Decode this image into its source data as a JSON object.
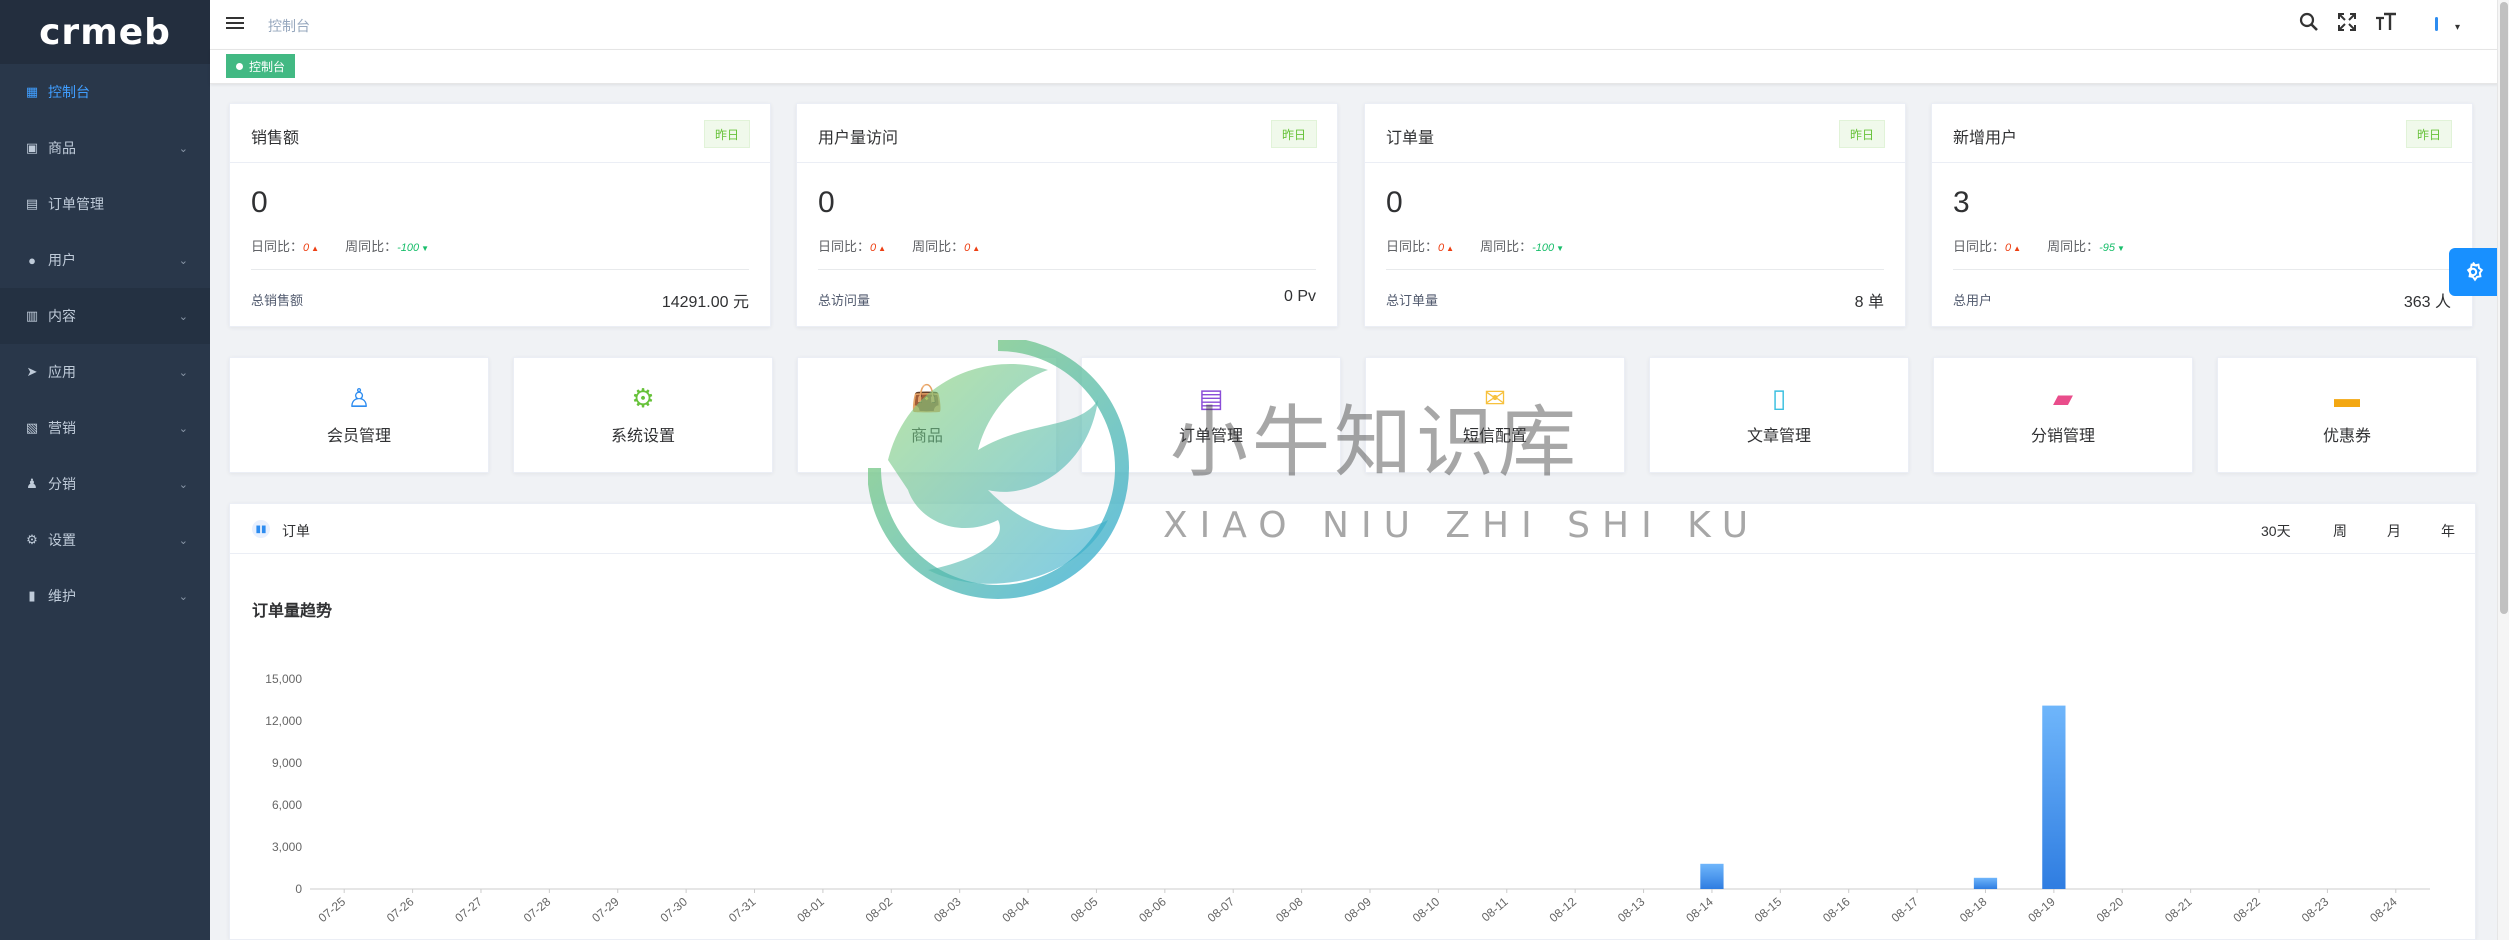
{
  "app": {
    "logo": "crmeb"
  },
  "sidebar": {
    "items": [
      {
        "label": "控制台",
        "icon": "dashboard-icon",
        "glyph": "▦",
        "active": true,
        "chevron": false
      },
      {
        "label": "商品",
        "icon": "bag-icon",
        "glyph": "▣",
        "chevron": true
      },
      {
        "label": "订单管理",
        "icon": "clipboard-icon",
        "glyph": "▤",
        "chevron": false
      },
      {
        "label": "用户",
        "icon": "user-icon",
        "glyph": "●",
        "chevron": true
      },
      {
        "label": "内容",
        "icon": "bar-chart-icon",
        "glyph": "▥",
        "chevron": true,
        "hover": true
      },
      {
        "label": "应用",
        "icon": "paper-plane-icon",
        "glyph": "➤",
        "chevron": true
      },
      {
        "label": "营销",
        "icon": "image-icon",
        "glyph": "▧",
        "chevron": true
      },
      {
        "label": "分销",
        "icon": "person-icon",
        "glyph": "♟",
        "chevron": true
      },
      {
        "label": "设置",
        "icon": "gear-icon",
        "glyph": "⚙",
        "chevron": true
      },
      {
        "label": "维护",
        "icon": "paint-roller-icon",
        "glyph": "▮",
        "chevron": true
      }
    ],
    "chevron_glyph": "⌄"
  },
  "header": {
    "breadcrumb": "控制台",
    "tags": [
      "控制台"
    ]
  },
  "stats": [
    {
      "title": "销售额",
      "badge": "昨日",
      "value": "0",
      "day_label": "日同比：",
      "day_value": "0",
      "day_dir": "up",
      "week_label": "周同比：",
      "week_value": "-100",
      "week_dir": "down",
      "total_label": "总销售额",
      "total_value": "14291.00 元"
    },
    {
      "title": "用户量访问",
      "badge": "昨日",
      "value": "0",
      "day_label": "日同比：",
      "day_value": "0",
      "day_dir": "up",
      "week_label": "周同比：",
      "week_value": "0",
      "week_dir": "up",
      "total_label": "总访问量",
      "total_value": "0 Pv"
    },
    {
      "title": "订单量",
      "badge": "昨日",
      "value": "0",
      "day_label": "日同比：",
      "day_value": "0",
      "day_dir": "up",
      "week_label": "周同比：",
      "week_value": "-100",
      "week_dir": "down",
      "total_label": "总订单量",
      "total_value": "8 单"
    },
    {
      "title": "新增用户",
      "badge": "昨日",
      "value": "3",
      "day_label": "日同比：",
      "day_value": "0",
      "day_dir": "up",
      "week_label": "周同比：",
      "week_value": "-95",
      "week_dir": "down",
      "total_label": "总用户",
      "total_value": "363 人"
    }
  ],
  "quick_nav": [
    {
      "label": "会员管理",
      "icon": "user-outline-icon",
      "glyph": "♙",
      "color": "#2d8cf0"
    },
    {
      "label": "系统设置",
      "icon": "settings-icon",
      "glyph": "⚙",
      "color": "#67c23a"
    },
    {
      "label": "商品",
      "icon": "shopping-bag-icon",
      "glyph": "👜",
      "color": "#f5845c"
    },
    {
      "label": "订单管理",
      "icon": "order-clipboard-icon",
      "glyph": "▤",
      "color": "#8a4dd8"
    },
    {
      "label": "短信配置",
      "icon": "mail-icon",
      "glyph": "✉",
      "color": "#f7c13d"
    },
    {
      "label": "文章管理",
      "icon": "notebook-icon",
      "glyph": "▯",
      "color": "#3cc0e0"
    },
    {
      "label": "分销管理",
      "icon": "wallet-icon",
      "glyph": "▰",
      "color": "#e94d8b"
    },
    {
      "label": "优惠券",
      "icon": "coupon-icon",
      "glyph": "▬",
      "color": "#f3a712"
    }
  ],
  "chart_section": {
    "title": "订单",
    "subtitle": "订单量趋势",
    "ranges": [
      {
        "label": "30天",
        "active": true
      },
      {
        "label": "周",
        "active": false
      },
      {
        "label": "月",
        "active": false
      },
      {
        "label": "年",
        "active": false
      }
    ]
  },
  "chart_data": {
    "type": "bar",
    "title": "订单量趋势",
    "xlabel": "",
    "ylabel": "",
    "ylim": [
      0,
      15000
    ],
    "yticks": [
      0,
      3000,
      6000,
      9000,
      12000,
      15000
    ],
    "ytick_labels": [
      "0",
      "3,000",
      "6,000",
      "9,000",
      "12,000",
      "15,000"
    ],
    "categories": [
      "07-25",
      "07-26",
      "07-27",
      "07-28",
      "07-29",
      "07-30",
      "07-31",
      "08-01",
      "08-02",
      "08-03",
      "08-04",
      "08-05",
      "08-06",
      "08-07",
      "08-08",
      "08-09",
      "08-10",
      "08-11",
      "08-12",
      "08-13",
      "08-14",
      "08-15",
      "08-16",
      "08-17",
      "08-18",
      "08-19",
      "08-20",
      "08-21",
      "08-22",
      "08-23",
      "08-24"
    ],
    "values": [
      0,
      0,
      0,
      0,
      0,
      0,
      0,
      0,
      0,
      0,
      0,
      0,
      0,
      0,
      0,
      0,
      0,
      0,
      0,
      0,
      1800,
      0,
      0,
      0,
      800,
      13100,
      0,
      0,
      0,
      0,
      0
    ],
    "grid": false,
    "bar_color_top": "#6fb6fb",
    "bar_color_bottom": "#2f7de1"
  },
  "watermark": {
    "text": "小牛知识库",
    "sub": "XIAO NIU ZHI SHI KU"
  }
}
